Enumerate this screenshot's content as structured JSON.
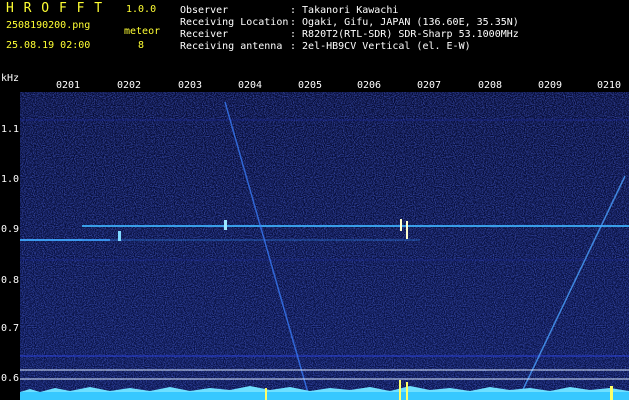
{
  "header": {
    "app_name": "H R O F F T",
    "version": "1.0.0",
    "filename": "2508190200.png",
    "datetime": "25.08.19 02:00",
    "meteor_label": "meteor",
    "meteor_count": "8"
  },
  "info": {
    "observer_label": "Observer",
    "observer_value": ": Takanori Kawachi",
    "location_label": "Receiving Location",
    "location_value": ": Ogaki, Gifu, JAPAN (136.60E, 35.35N)",
    "receiver_label": "Receiver",
    "receiver_value": ": R820T2(RTL-SDR) SDR-Sharp 53.1000MHz",
    "antenna_label": "Receiving antenna",
    "antenna_value": ": 2el-HB9CV Vertical (el. E-W)"
  },
  "chart_data": {
    "type": "heatmap",
    "ylabel": "kHz",
    "x_ticks": [
      "0201",
      "0202",
      "0203",
      "0204",
      "0205",
      "0206",
      "0207",
      "0208",
      "0209",
      "0210"
    ],
    "y_ticks": [
      "1.1",
      "1.0",
      "0.9",
      "0.8",
      "0.7",
      "0.6"
    ],
    "y_range": [
      0.58,
      1.18
    ]
  },
  "colors": {
    "background": "#000000",
    "title_yellow": "#ffff33",
    "signal_cyan": "#33ccff",
    "noise_blue": "#1a2a9a"
  }
}
